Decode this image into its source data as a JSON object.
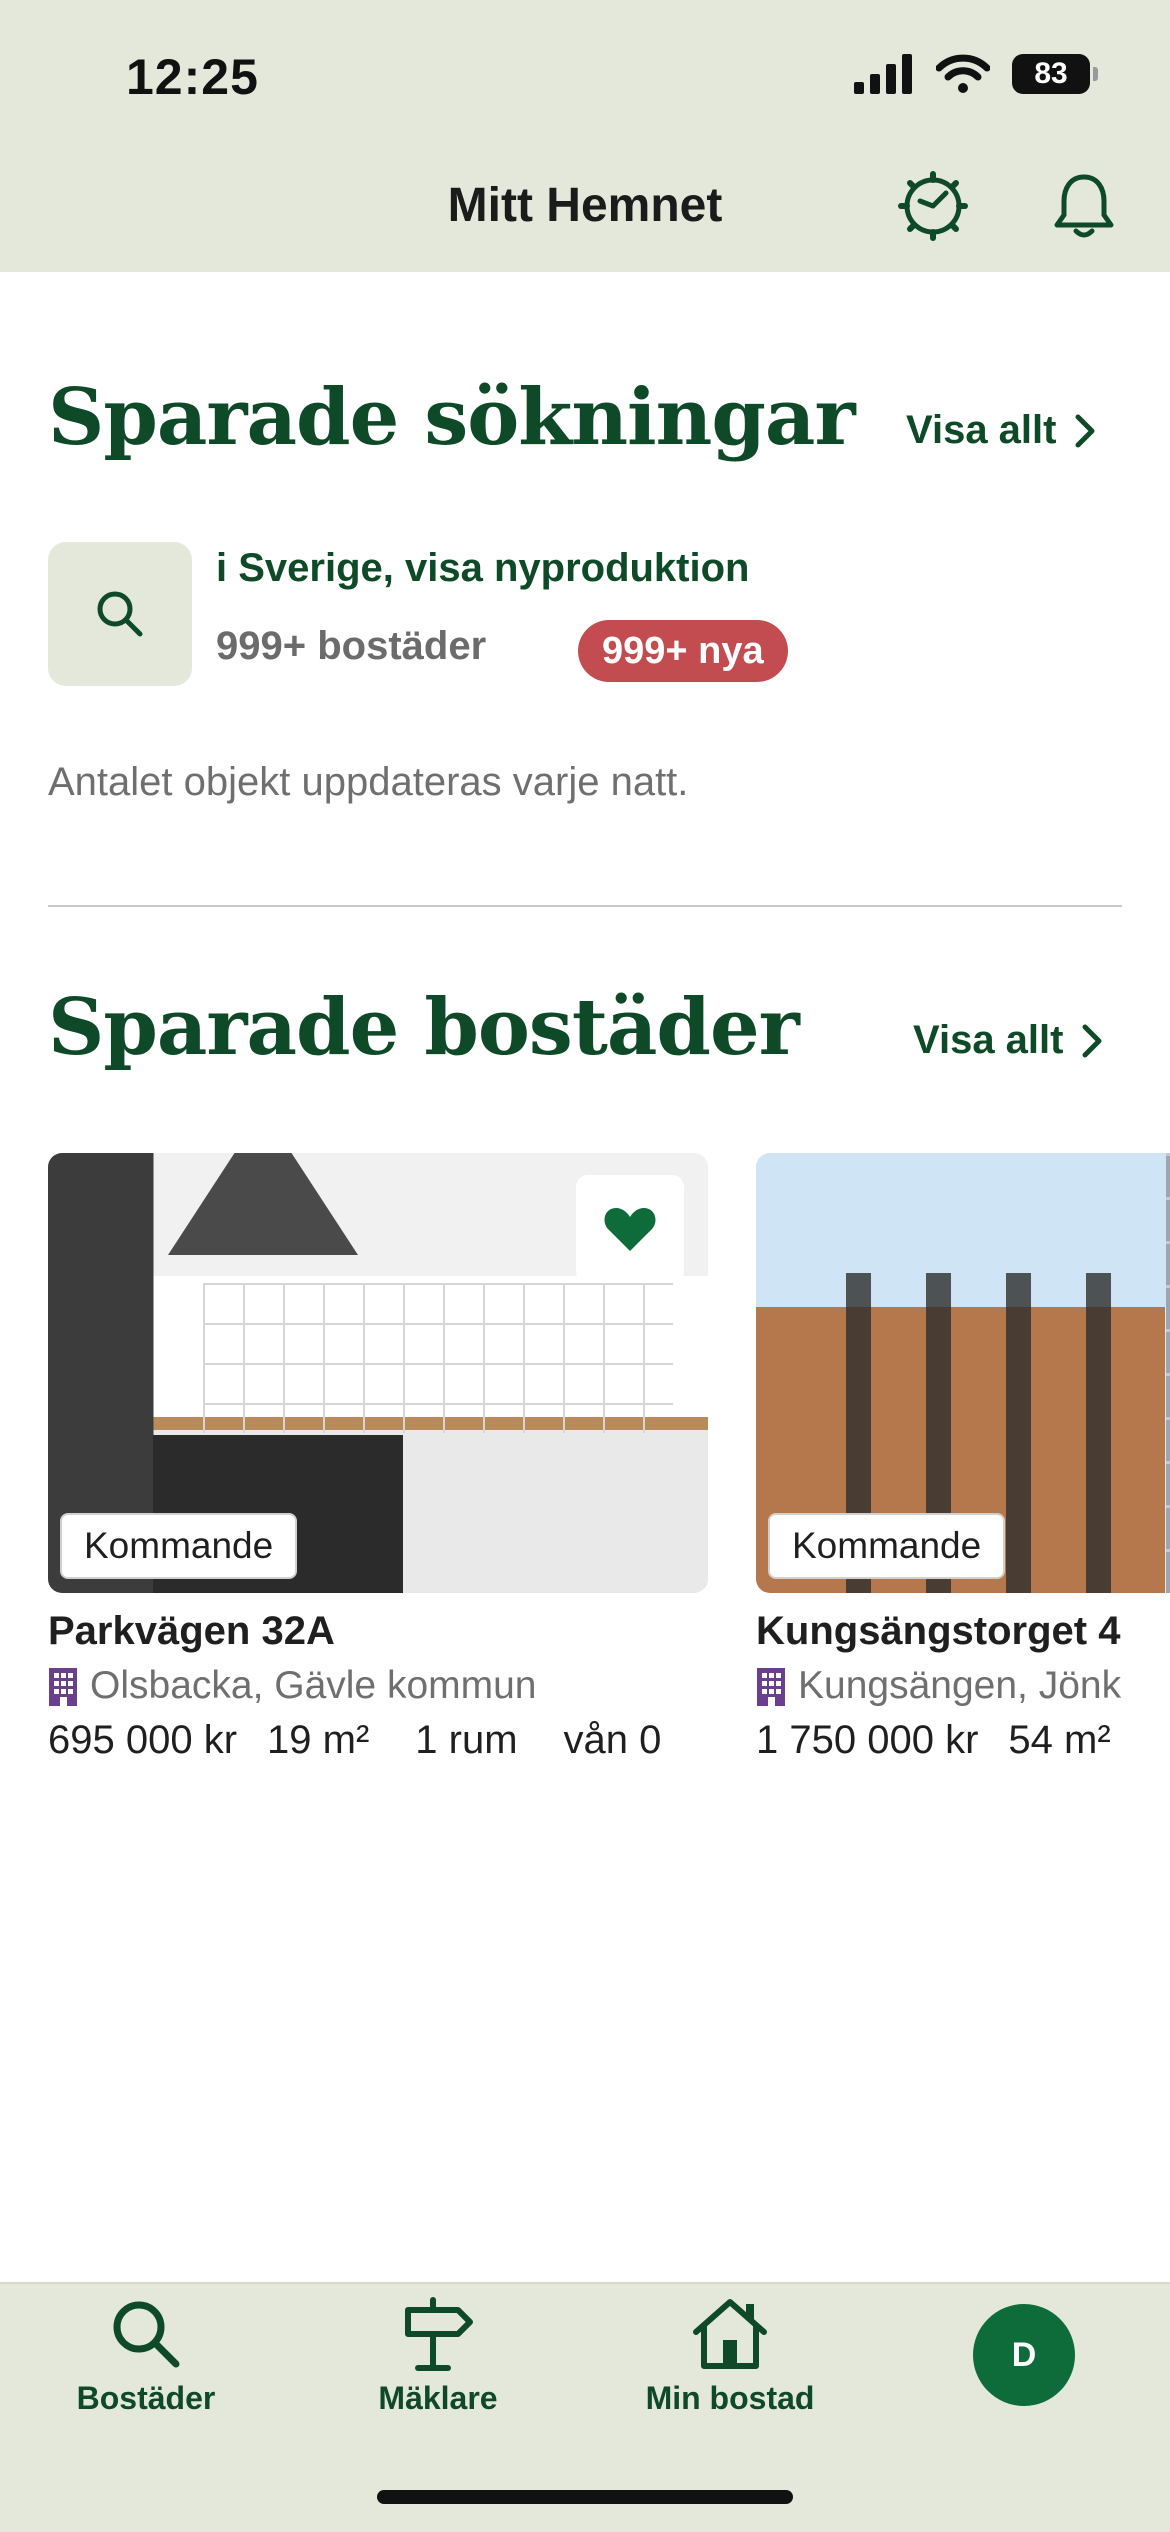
{
  "status": {
    "time": "12:25",
    "battery": "83"
  },
  "header": {
    "title": "Mitt Hemnet"
  },
  "saved_searches": {
    "title": "Sparade sökningar",
    "view_all": "Visa allt",
    "item": {
      "title": "i Sverige, visa nyproduktion",
      "count": "999+ bostäder",
      "new_badge": "999+ nya"
    },
    "note": "Antalet objekt uppdateras varje natt."
  },
  "saved_homes": {
    "title": "Sparade bostäder",
    "view_all": "Visa allt",
    "cards": [
      {
        "tag": "Kommande",
        "title": "Parkvägen 32A",
        "location": "Olsbacka, Gävle kommun",
        "price": "695 000 kr",
        "area": "19 m²",
        "rooms": "1 rum",
        "floor": "vån 0"
      },
      {
        "tag": "Kommande",
        "title": "Kungsängstorget 4",
        "location": "Kungsängen, Jönk",
        "price": "1 750 000 kr",
        "area": "54 m²"
      }
    ]
  },
  "nav": {
    "items": [
      {
        "label": "Bostäder"
      },
      {
        "label": "Mäklare"
      },
      {
        "label": "Min bostad"
      }
    ],
    "avatar_initial": "D"
  },
  "colors": {
    "brand_green": "#0e4a27",
    "top_bg": "#e4e8db",
    "badge_red": "#c24c4f",
    "avatar_green": "#0e6b3a"
  }
}
